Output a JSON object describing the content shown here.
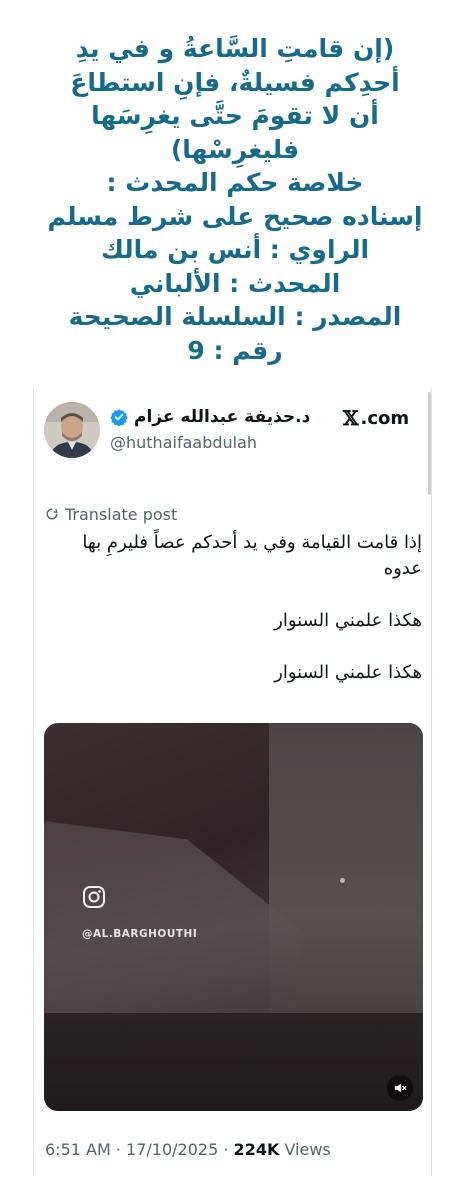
{
  "hadith": {
    "lines": [
      "(إن قامتِ السَّاعةُ و في يدِ",
      "أحدِكم فسيلةٌ، فإنِ استطاعَ",
      "أن لا تقومَ حتَّى يغرِسَها",
      "فليغرِسْها)",
      "خلاصة حكم المحدث :",
      "إسناده صحيح على شرط مسلم",
      "الراوي : أنس بن مالك",
      "المحدث : الألباني",
      "المصدر : السلسلة الصحيحة",
      "رقم : 9"
    ]
  },
  "post": {
    "source": ".com",
    "display_name": "د.حذيفة عبدالله عزام",
    "handle": "@huthaifaabdulah",
    "translate_label": "Translate post",
    "paragraphs": [
      "إذا قامت القيامة وفي يد أحدكم عصاً فليرمِ بها",
      "عدوه",
      "هكذا علمني السنوار",
      "هكذا علمني السنوار"
    ],
    "media": {
      "watermark_handle": "@AL.BARGHOUTHI"
    },
    "time": "6:51 AM",
    "date": "17/10/2025",
    "views_count": "224K",
    "views_label": "Views",
    "separator": "·"
  },
  "colors": {
    "hadith_text": "#176a8c",
    "verified_badge": "#1d9bf0",
    "secondary_text": "#536471",
    "primary_text": "#0f1419"
  }
}
